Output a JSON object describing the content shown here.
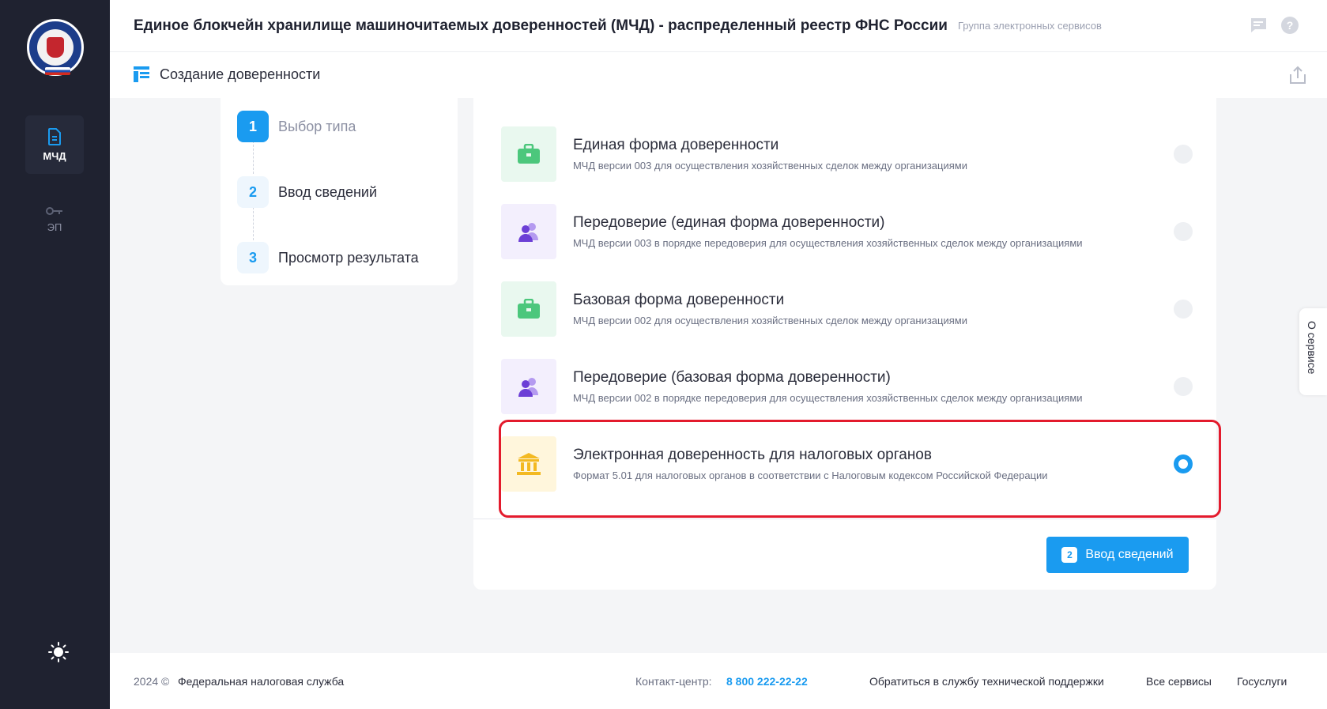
{
  "sidebar": {
    "items": [
      {
        "label": "МЧД",
        "icon": "document-icon",
        "active": true
      },
      {
        "label": "ЭП",
        "icon": "key-icon",
        "active": false
      }
    ],
    "theme_icon": "sun-icon"
  },
  "header": {
    "title": "Единое блокчейн хранилище машиночитаемых доверенностей (МЧД) - распределенный реестр ФНС России",
    "group_link": "Группа электронных сервисов"
  },
  "page": {
    "title": "Создание доверенности"
  },
  "stepper": {
    "steps": [
      {
        "num": "1",
        "label": "Выбор типа",
        "active": true
      },
      {
        "num": "2",
        "label": "Ввод сведений",
        "active": false
      },
      {
        "num": "3",
        "label": "Просмотр результата",
        "active": false
      }
    ]
  },
  "options": [
    {
      "title": "Единая форма доверенности",
      "desc": "МЧД версии 003 для осуществления хозяйственных сделок между организациями",
      "icon": "briefcase-icon",
      "checked": false
    },
    {
      "title": "Передоверие (единая форма доверенности)",
      "desc": "МЧД версии 003 в порядке передоверия для осуществления хозяйственных сделок между организациями",
      "icon": "users-icon",
      "checked": false
    },
    {
      "title": "Базовая форма доверенности",
      "desc": "МЧД версии 002 для осуществления хозяйственных сделок между организациями",
      "icon": "briefcase-icon",
      "checked": false
    },
    {
      "title": "Передоверие (базовая форма доверенности)",
      "desc": "МЧД версии 002 в порядке передоверия для осуществления хозяйственных сделок между организациями",
      "icon": "users-icon",
      "checked": false
    },
    {
      "title": "Электронная доверенность для налоговых органов",
      "desc": "Формат 5.01 для налоговых органов в соответствии с Налоговым кодексом Российской Федерации",
      "icon": "bank-icon",
      "checked": true
    }
  ],
  "next_button": {
    "badge": "2",
    "label": "Ввод сведений"
  },
  "about_tab": "О сервисе",
  "footer": {
    "year": "2024 ©",
    "org": "Федеральная налоговая служба",
    "contact_label": "Контакт-центр:",
    "contact_phone": "8 800 222-22-22",
    "support": "Обратиться в службу технической поддержки",
    "all_services": "Все сервисы",
    "gosuslugi": "Госуслуги"
  },
  "colors": {
    "accent": "#1a9bf0",
    "sidebar_bg": "#1f2230",
    "highlight": "#e31b2d"
  }
}
